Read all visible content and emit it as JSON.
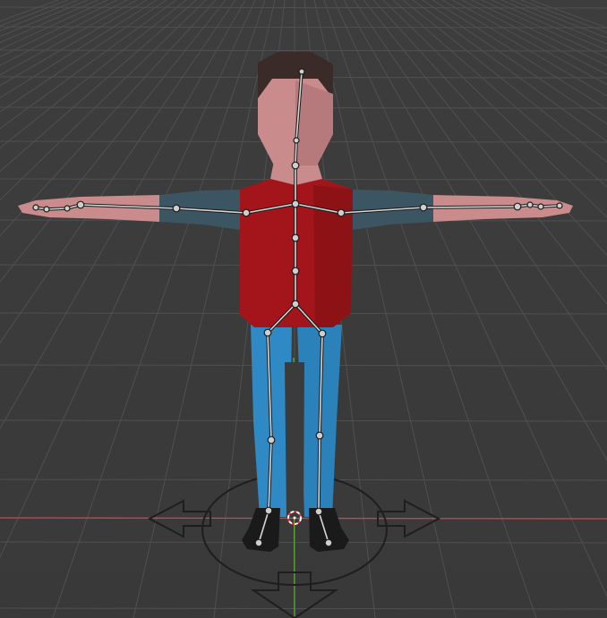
{
  "viewport": {
    "editor": "3D Viewport",
    "background_color": "#3b3b3b",
    "grid_color": "#505050",
    "x_axis_color": "#c24a4f",
    "y_axis_color": "#5fa73a"
  },
  "scene": {
    "character": {
      "skin_color": "#c98b8b",
      "hair_color": "#3a2a28",
      "shirt_color": "#a3151a",
      "sleeve_color": "#3c5562",
      "pants_color": "#2e89c4",
      "shoe_color": "#1a1a1a"
    },
    "armature": {
      "bone_color": "#d6d6d6",
      "joint_color": "#cfcfcf",
      "outline_color": "#1b1b1b"
    },
    "gizmo": {
      "type": "move-all-directions",
      "color": "#1e1e1e"
    },
    "origin_cursor": {
      "ring_color_a": "#ffffff",
      "ring_color_b": "#e23a3a"
    }
  }
}
